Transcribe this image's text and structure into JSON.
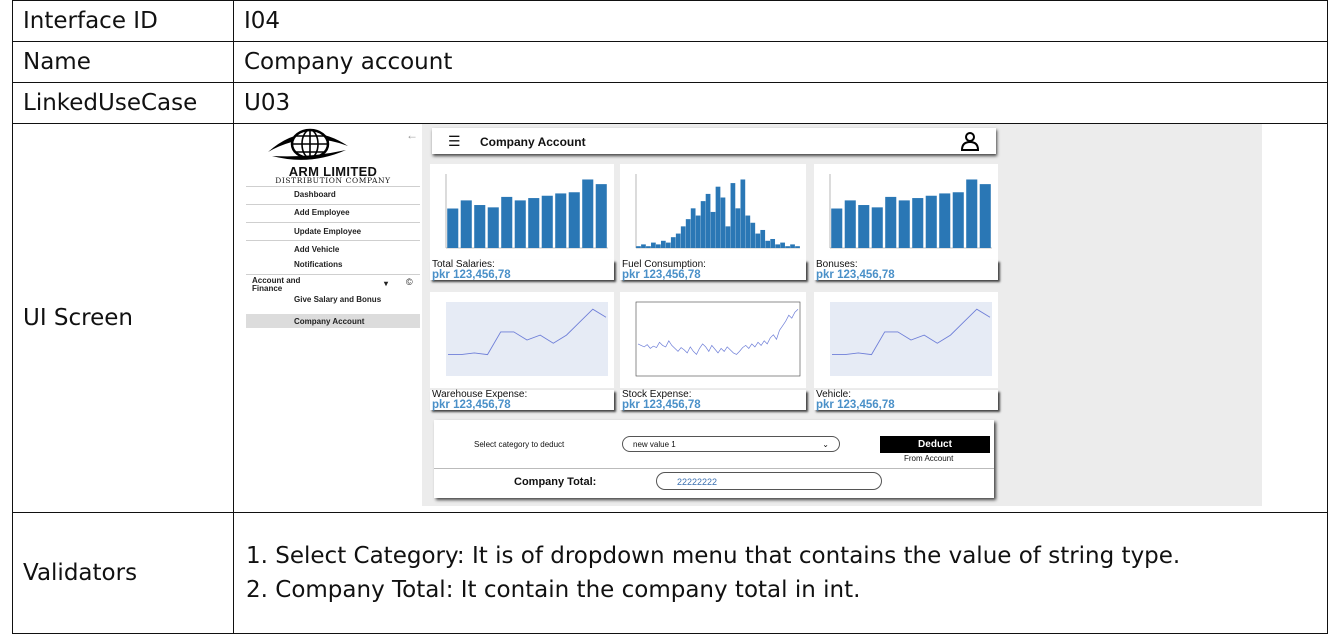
{
  "table": {
    "rows": [
      {
        "label": "Interface ID",
        "value": "I04"
      },
      {
        "label": "Name",
        "value": "Company account"
      },
      {
        "label": "LinkedUseCase",
        "value": "U03"
      }
    ],
    "ui_label": "UI Screen",
    "validators_label": "Validators",
    "validators": [
      "1. Select Category: It is of dropdown menu that contains the value of string type.",
      "2. Company Total: It contain the company total in int."
    ]
  },
  "app": {
    "brand": "ARM LIMITED",
    "brand_sub": "DISTRIBUTION COMPANY",
    "sidebar": {
      "items": [
        "Dashboard",
        "Add Employee",
        "Update Employee",
        "Add Vehicle",
        "Notifications"
      ],
      "group": "Account and Finance",
      "group_badge": "©",
      "sub_items": [
        "Give Salary and Bonus",
        "Company Account"
      ]
    },
    "page_title": "Company Account",
    "cards": [
      {
        "label": "Total Salaries:",
        "value": "pkr 123,456,78"
      },
      {
        "label": "Fuel Consumption:",
        "value": "pkr 123,456,78"
      },
      {
        "label": "Bonuses:",
        "value": "pkr 123,456,78"
      },
      {
        "label": "Warehouse Expense:",
        "value": "pkr 123,456,78"
      },
      {
        "label": "Stock Expense:",
        "value": "pkr 123,456,78"
      },
      {
        "label": "Vehicle:",
        "value": "pkr 123,456,78"
      }
    ],
    "deduct": {
      "select_label": "Select category to deduct",
      "select_value": "new value 1",
      "button": "Deduct",
      "button_sub": "From Account"
    },
    "total": {
      "label": "Company Total:",
      "value": "22222222"
    },
    "colors": {
      "bar": "#2a77b5",
      "line": "#6f7fd8",
      "value_text": "#4a90c8"
    }
  },
  "chart_data": [
    {
      "type": "bar",
      "values": [
        17,
        20.5,
        18.5,
        17.5,
        22,
        20.5,
        21.5,
        22.5,
        23.5,
        24,
        29.5,
        27.5
      ]
    },
    {
      "type": "bar",
      "values": [
        1,
        2,
        1,
        3,
        2,
        4,
        3,
        6,
        8,
        12,
        16,
        22,
        18,
        26,
        30,
        20,
        34,
        28,
        12,
        36,
        22,
        38,
        18,
        14,
        8,
        10,
        4,
        5,
        2,
        3,
        1,
        2,
        1
      ]
    },
    {
      "type": "bar",
      "values": [
        17,
        20.5,
        18.5,
        17.5,
        22,
        20.5,
        21.5,
        22.5,
        23.5,
        24,
        29.5,
        27.5
      ]
    },
    {
      "type": "line",
      "values": [
        12,
        12,
        13,
        12,
        26,
        26,
        21,
        24,
        19,
        24,
        32,
        40,
        35
      ]
    },
    {
      "type": "line",
      "values": [
        40,
        38,
        36,
        39,
        34,
        37,
        35,
        42,
        38,
        36,
        44,
        38,
        34,
        30,
        35,
        32,
        28,
        36,
        30,
        26,
        34,
        40,
        36,
        30,
        38,
        33,
        28,
        34,
        30,
        36,
        32,
        28,
        26,
        30,
        35,
        38,
        34,
        40,
        36,
        42,
        38,
        44,
        40,
        48,
        52,
        46,
        58,
        64,
        70,
        78,
        74,
        82,
        86
      ]
    },
    {
      "type": "line",
      "values": [
        12,
        12,
        13,
        12,
        26,
        26,
        21,
        24,
        19,
        24,
        32,
        40,
        35
      ]
    }
  ]
}
